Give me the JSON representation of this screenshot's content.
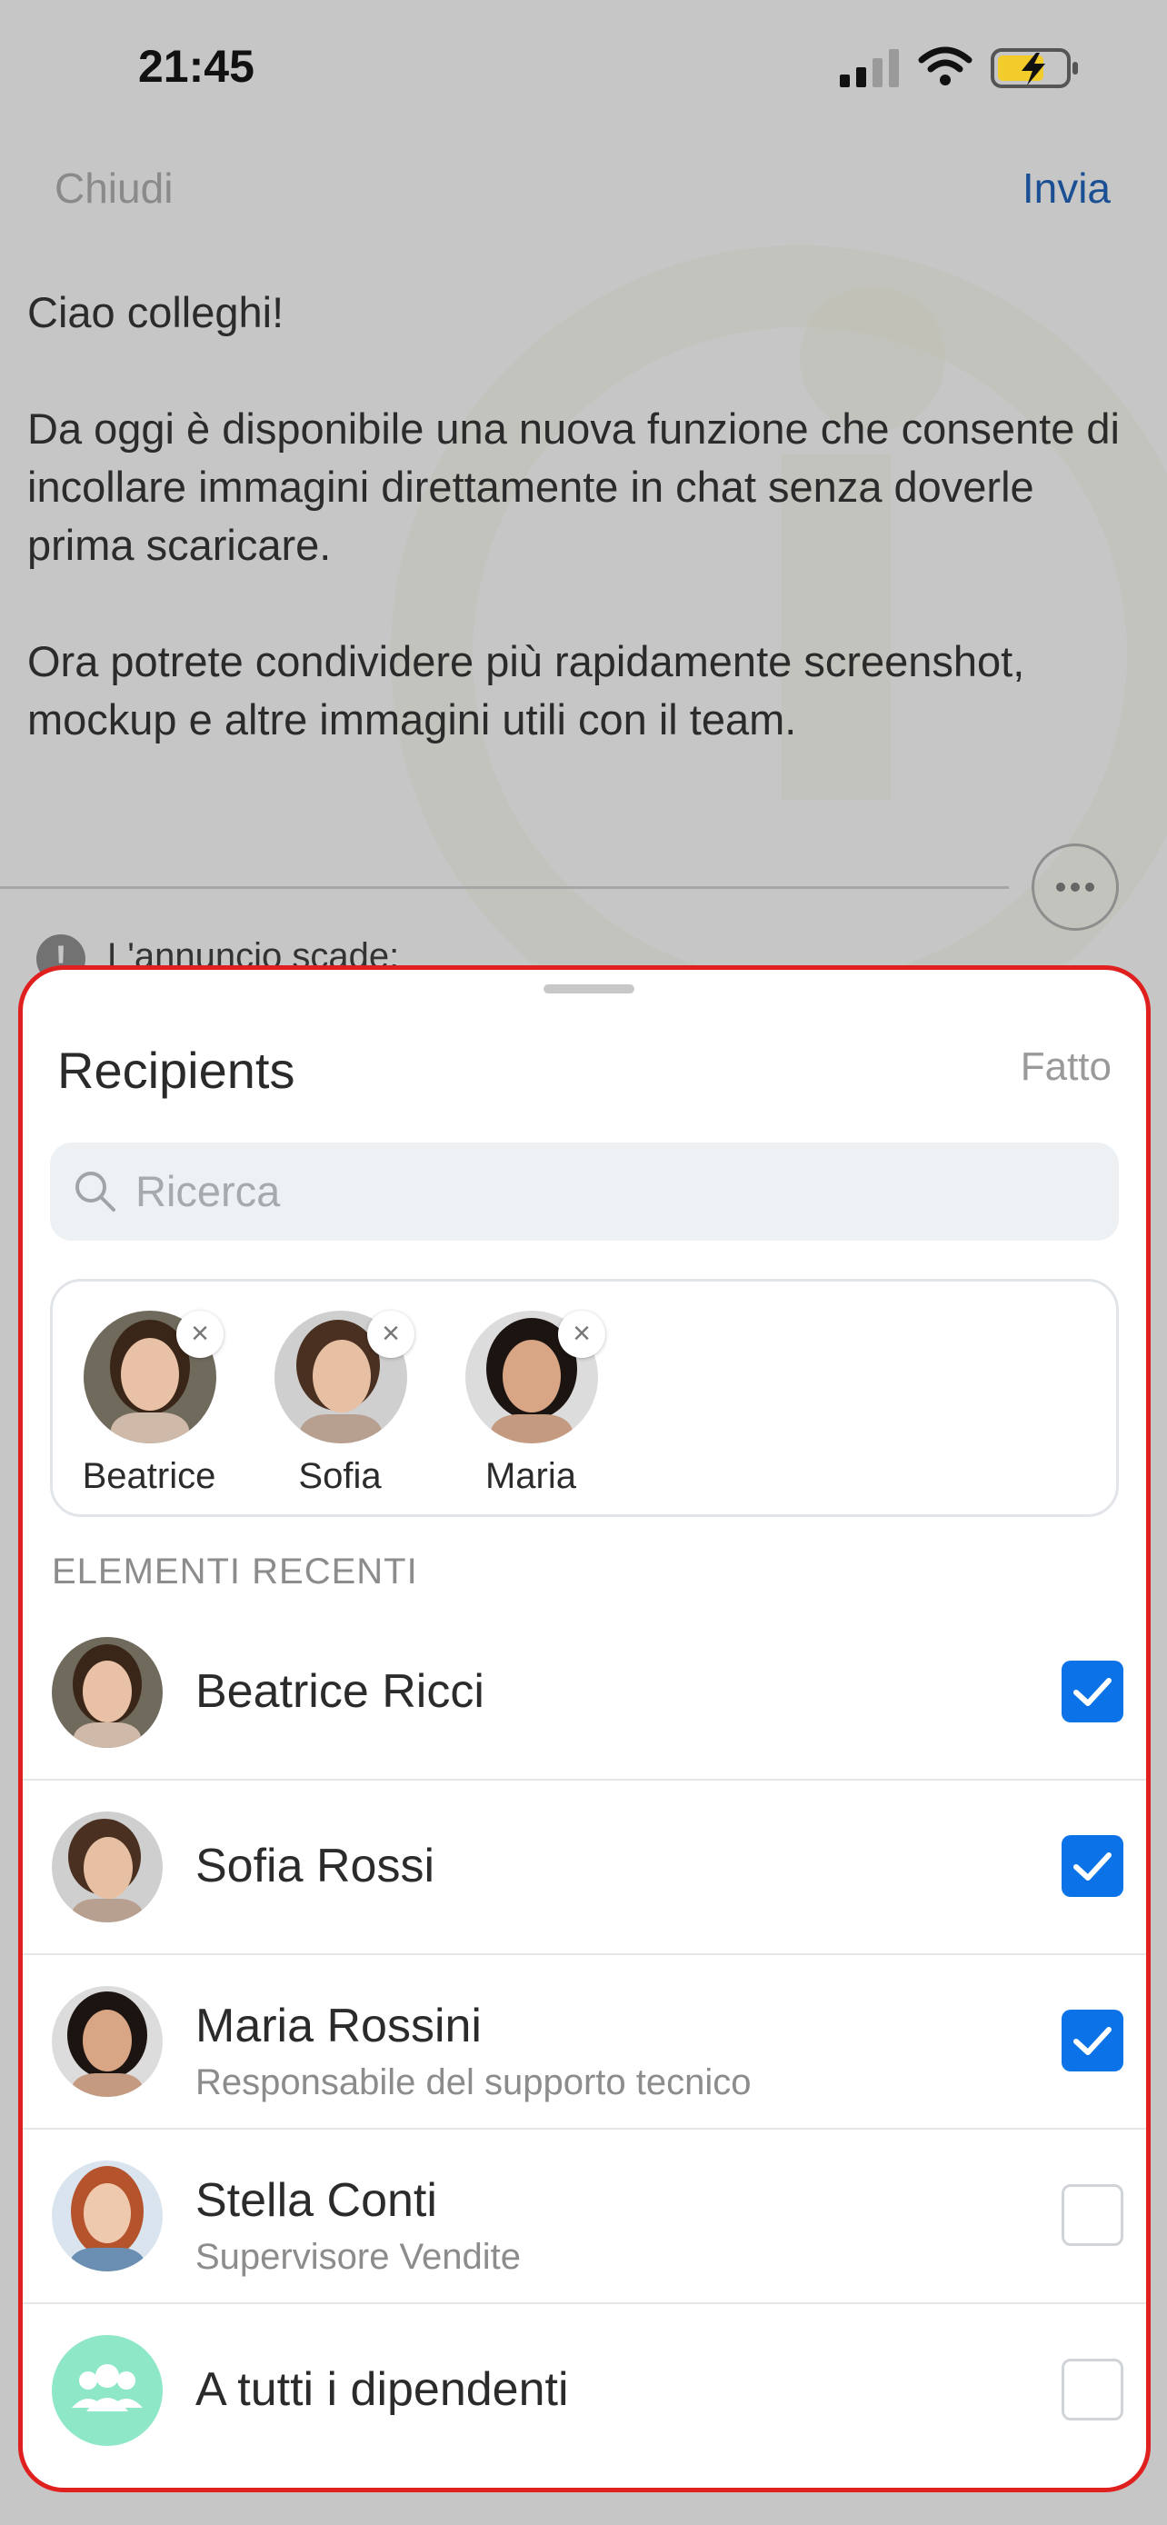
{
  "status_bar": {
    "time": "21:45"
  },
  "nav": {
    "close_label": "Chiudi",
    "send_label": "Invia"
  },
  "message": {
    "paragraphs": [
      "Ciao colleghi!",
      "Da oggi è disponibile una nuova funzione che consente di incollare immagini direttamente in chat senza doverle prima scaricare.",
      "Ora potrete condividere più rapidamente screenshot, mockup e altre immagini utili con il team."
    ],
    "expiry_label": "L'annuncio scade:"
  },
  "sheet": {
    "title": "Recipients",
    "done_label": "Fatto",
    "search_placeholder": "Ricerca",
    "selected": [
      {
        "name": "Beatrice"
      },
      {
        "name": "Sofia"
      },
      {
        "name": "Maria"
      }
    ],
    "section_label": "ELEMENTI RECENTI",
    "recents": [
      {
        "name": "Beatrice Ricci",
        "subtitle": "",
        "checked": true
      },
      {
        "name": "Sofia Rossi",
        "subtitle": "",
        "checked": true
      },
      {
        "name": "Maria Rossini",
        "subtitle": "Responsabile del supporto tecnico",
        "checked": true
      },
      {
        "name": "Stella Conti",
        "subtitle": "Supervisore Vendite",
        "checked": false
      },
      {
        "name": "A tutti i dipendenti",
        "subtitle": "",
        "checked": false
      }
    ],
    "accent_color": "#0b72e7",
    "highlight_color": "#e0201f"
  }
}
